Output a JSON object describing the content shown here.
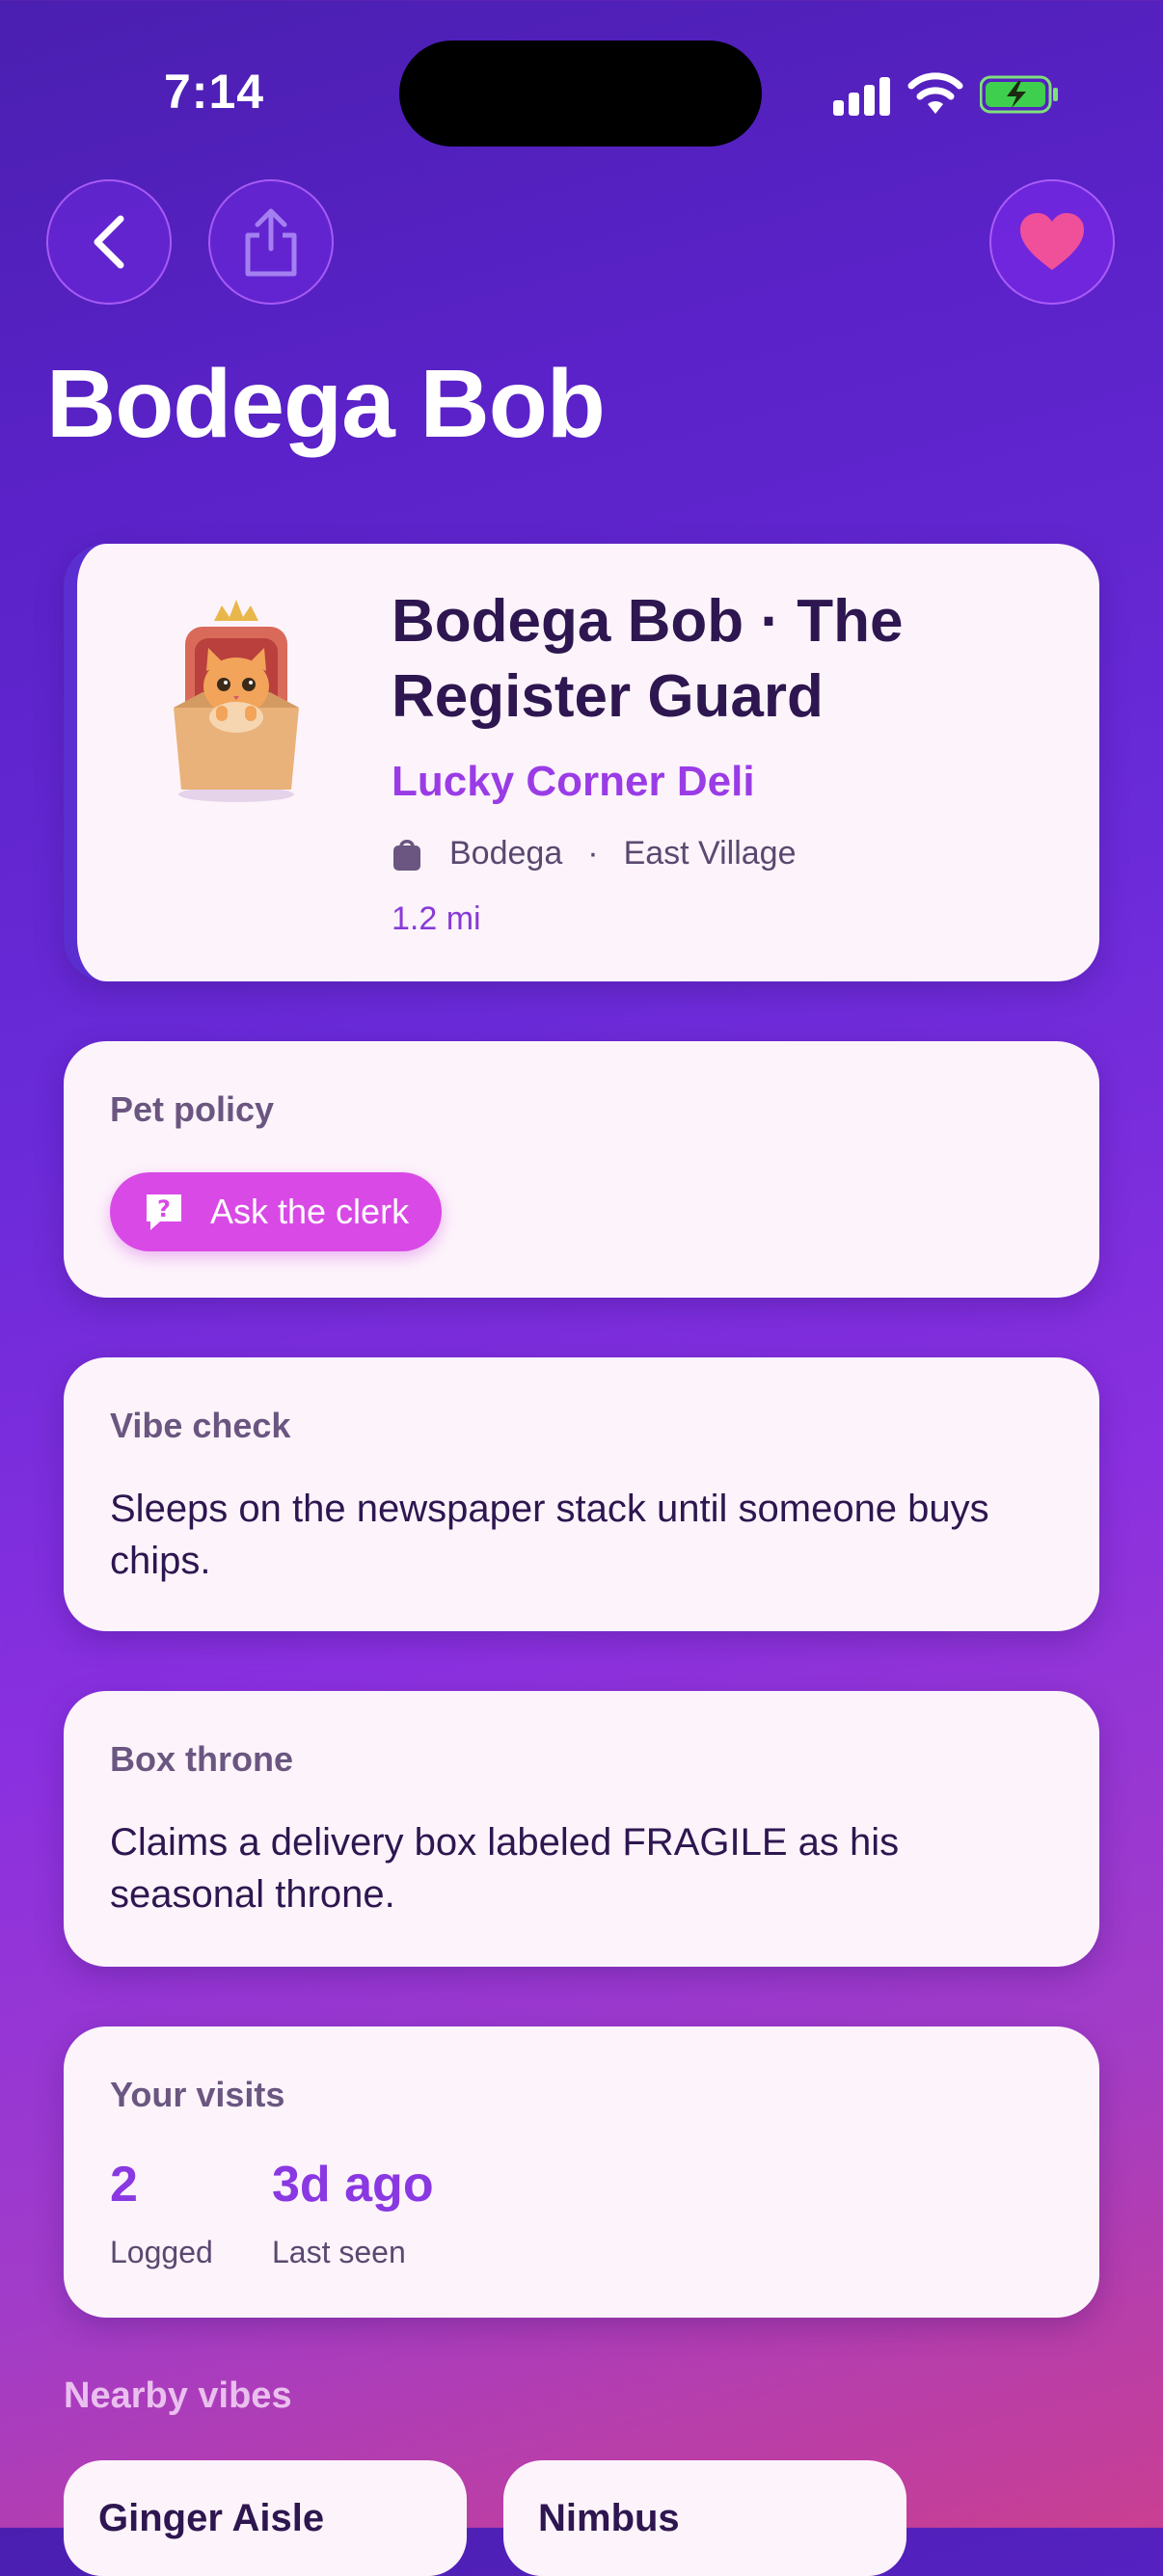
{
  "status": {
    "time": "7:14"
  },
  "header": {
    "title": "Bodega Bob"
  },
  "hero": {
    "name": "Bodega Bob · The Register Guard",
    "shop": "Lucky Corner Deli",
    "category": "Bodega",
    "separator": "·",
    "neighborhood": "East Village",
    "distance": "1.2 mi"
  },
  "policy": {
    "label": "Pet policy",
    "button": "Ask the clerk"
  },
  "vibe": {
    "label": "Vibe check",
    "text": "Sleeps on the newspaper stack until someone buys chips."
  },
  "box": {
    "label": "Box throne",
    "text": "Claims a delivery box labeled FRAGILE as his seasonal throne."
  },
  "visits": {
    "label": "Your visits",
    "stats": [
      {
        "value": "2",
        "label": "Logged"
      },
      {
        "value": "3d ago",
        "label": "Last seen"
      }
    ]
  },
  "nearby": {
    "title": "Nearby vibes",
    "items": [
      {
        "name": "Ginger Aisle"
      },
      {
        "name": "Nimbus"
      }
    ]
  },
  "colors": {
    "accent": "#9a3ce6",
    "heart": "#f0509a",
    "button": "#d949e6"
  }
}
